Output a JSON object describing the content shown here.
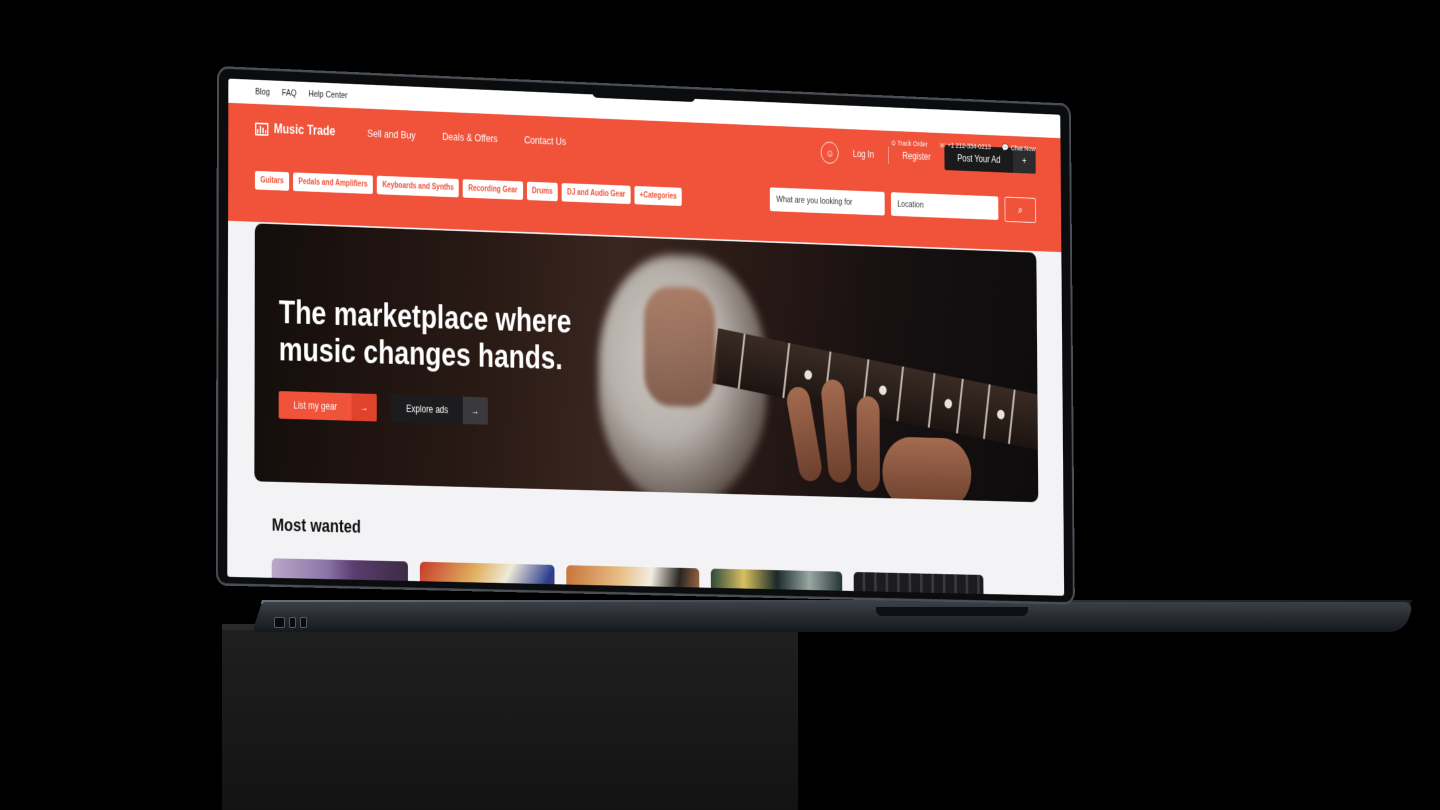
{
  "topbar": {
    "links": [
      "Blog",
      "FAQ",
      "Help Center"
    ]
  },
  "utility": {
    "track_order": "Track Order",
    "phone": "+1 212-334-0213",
    "chat": "Chat Now"
  },
  "header": {
    "logo": "Music Trade",
    "nav": [
      "Sell and Buy",
      "Deals & Offers",
      "Contact Us"
    ],
    "login": "Log In",
    "register": "Register",
    "post_ad": "Post Your Ad",
    "post_ad_icon": "+"
  },
  "categories": [
    "Guitars",
    "Pedals and Amplifiers",
    "Keyboards and Synths",
    "Recording Gear",
    "Drums",
    "DJ and Audio Gear",
    "+Categories"
  ],
  "search": {
    "query_placeholder": "What are you looking for",
    "location_placeholder": "Location"
  },
  "hero": {
    "headline": "The marketplace where music changes hands.",
    "primary_button": "List my gear",
    "secondary_button": "Explore ads"
  },
  "most_wanted": {
    "title": "Most wanted"
  },
  "colors": {
    "brand": "#f0523a",
    "dark": "#1a1a1a"
  }
}
